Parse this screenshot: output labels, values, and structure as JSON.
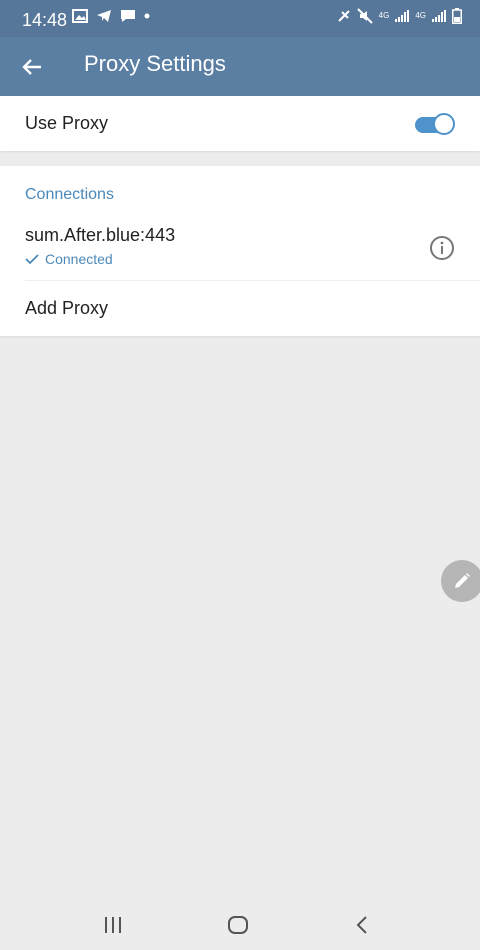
{
  "status_bar": {
    "time": "14:48",
    "network_label_1": "4G",
    "network_label_2": "4G"
  },
  "app_bar": {
    "title": "Proxy Settings",
    "back_icon": "arrow-left-icon"
  },
  "use_proxy": {
    "label": "Use Proxy",
    "enabled": true
  },
  "connections": {
    "header": "Connections",
    "items": [
      {
        "address": "sum.After.blue:443",
        "status": "Connected"
      }
    ],
    "add_label": "Add Proxy"
  },
  "colors": {
    "status_bar": "#56779a",
    "app_bar": "#5b7ea3",
    "accent": "#4f93cc",
    "section_header": "#4b88b8",
    "background": "#ececec"
  },
  "icons": {
    "info": "info-icon",
    "check": "check-icon",
    "edit": "pencil-icon",
    "nav_recents": "recents-icon",
    "nav_home": "home-icon",
    "nav_back": "nav-back-icon"
  }
}
